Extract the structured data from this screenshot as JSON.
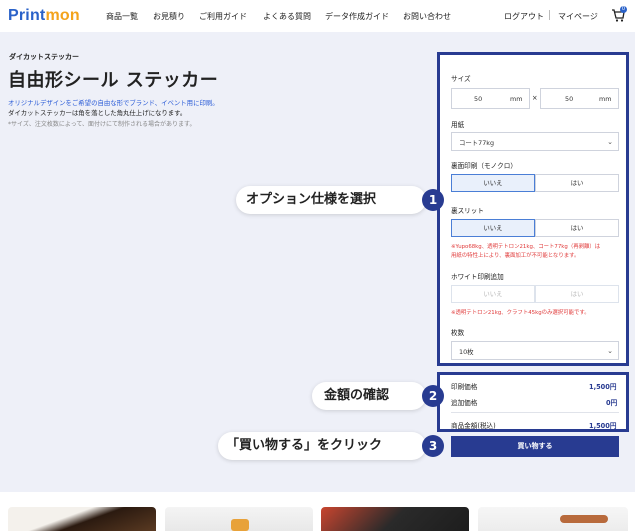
{
  "header": {
    "logo_part1": "Print",
    "logo_part2": "mon",
    "nav": [
      "商品一覧",
      "お見積り",
      "ご利用ガイド",
      "よくある質問",
      "データ作成ガイド",
      "お問い合わせ"
    ],
    "logout": "ログアウト",
    "mypage": "マイページ",
    "cart_count": "0"
  },
  "product": {
    "subtitle": "ダイカットステッカー",
    "title": "自由形シール ステッカー",
    "desc_line1": "オリジナルデザインをご希望の自由な形でブランド、イベント用に印刷。",
    "desc_line2": "ダイカットステッカーは角を落とした角丸仕上げになります。",
    "note": "*サイズ、注文枚数によって、面付けにて制作される場合があります。"
  },
  "options": {
    "size_label": "サイズ",
    "width_value": "50",
    "height_value": "50",
    "unit": "mm",
    "times": "×",
    "paper_label": "用紙",
    "paper_value": "コート77kg",
    "back_print_label": "裏面印刷（モノクロ）",
    "back_print_no": "いいえ",
    "back_print_yes": "はい",
    "slit_label": "裏スリット",
    "slit_no": "いいえ",
    "slit_yes": "はい",
    "slit_warning_line1": "※Yupo68kg、透明テトロン21kg、コート77kg（再剥離）は",
    "slit_warning_line2": "用紙の特性上により、裏面加工が不可能となります。",
    "white_label": "ホワイト印刷追加",
    "white_no": "いいえ",
    "white_yes": "はい",
    "white_warning": "※透明テトロン21kg、クラフト45kgのみ選択可能です。",
    "qty_label": "枚数",
    "qty_value": "10枚"
  },
  "price": {
    "print_label": "印刷価格",
    "print_value": "1,500円",
    "extra_label": "追加価格",
    "extra_value": "0円",
    "total_label": "商品金額(税込)",
    "total_value": "1,500円",
    "buy_button": "買い物する"
  },
  "callouts": [
    {
      "text": "オプション仕様を選択",
      "number": "1"
    },
    {
      "text": "金額の確認",
      "number": "2"
    },
    {
      "text": "「買い物する」をクリック",
      "number": "3"
    }
  ],
  "colors": {
    "brand_blue": "#2a62c9",
    "brand_orange": "#f3a31c",
    "panel_border": "#283b91",
    "warning_red": "#e03a3a"
  }
}
